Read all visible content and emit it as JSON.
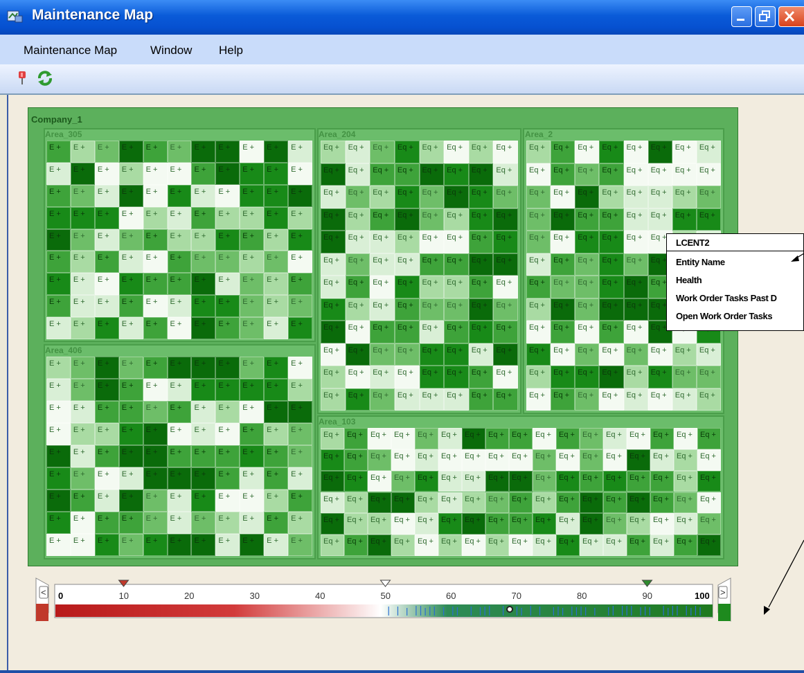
{
  "window": {
    "title": "Maintenance Map",
    "buttons": [
      "minimize",
      "restore",
      "close"
    ]
  },
  "menu": {
    "items": [
      {
        "label": "Maintenance Map"
      },
      {
        "label": "Window"
      },
      {
        "label": "Help"
      }
    ]
  },
  "toolbar": {
    "pin_icon": "pushpin-icon",
    "refresh_icon": "refresh-icon"
  },
  "map": {
    "company_label": "Company_1",
    "areas": [
      {
        "name": "Area_305",
        "code": "E"
      },
      {
        "name": "Area_204",
        "code": "Eq"
      },
      {
        "name": "Area_2",
        "code": "Eq"
      },
      {
        "name": "Area_406",
        "code": "E"
      },
      {
        "name": "Area_103",
        "code": "Eq"
      }
    ],
    "colors": {
      "background": "#5cb05c",
      "shades": [
        "#f4faf2",
        "#d9efd6",
        "#a9dba3",
        "#6ebe68",
        "#3ea33a",
        "#188a18",
        "#0a6b0a"
      ]
    }
  },
  "tooltip": {
    "title": "LCENT2",
    "lines": [
      "Entity Name",
      "Health",
      "Work Order Tasks Past D",
      "Open Work Order Tasks"
    ]
  },
  "slider": {
    "ticks": [
      "0",
      "10",
      "20",
      "30",
      "40",
      "50",
      "60",
      "70",
      "80",
      "90",
      "100"
    ],
    "left_button": "<",
    "right_button": ">",
    "markers": [
      {
        "value": 10,
        "color": "#c0392b"
      },
      {
        "value": 50,
        "color": "#ffffff"
      },
      {
        "value": 90,
        "color": "#2e8b2e"
      }
    ],
    "distribution_marker": 69
  }
}
